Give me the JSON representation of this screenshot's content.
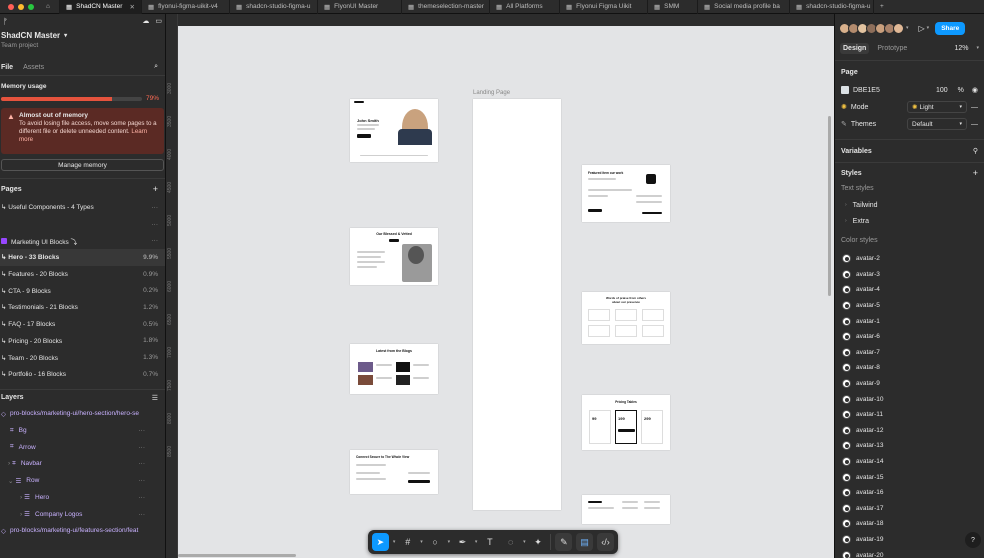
{
  "tabs": [
    {
      "label": "ShadCN Master",
      "active": true
    },
    {
      "label": "flyonui-figma-uikit-v4"
    },
    {
      "label": "shadcn-studio-figma-u"
    },
    {
      "label": "FlyonUI Master"
    },
    {
      "label": "themeselection-master"
    },
    {
      "label": "All Platforms"
    },
    {
      "label": "Flyonui Figma Uikit"
    },
    {
      "label": "SMM"
    },
    {
      "label": "Social media profile ba"
    },
    {
      "label": "shadcn-studio-figma-u"
    }
  ],
  "tabbar": {
    "add": "+"
  },
  "file": {
    "name": "ShadCN Master",
    "team": "Team project"
  },
  "left_tabs": {
    "file": "File",
    "assets": "Assets"
  },
  "memory": {
    "title": "Memory usage",
    "percent": "79%",
    "level": 0.79,
    "warning_title": "Almost out of memory",
    "warning_body": "To avoid losing file access, move some pages to a different file or delete unneeded content.",
    "learn_more": "Learn more",
    "manage": "Manage memory"
  },
  "pages": {
    "title": "Pages",
    "items": [
      {
        "label": "↳ Useful Components - 4 Types",
        "pct": ""
      },
      {
        "label": "",
        "pct": ""
      },
      {
        "label": "Marketing UI Blocks ⤵︎",
        "pct": "",
        "highlight": true
      },
      {
        "label": "↳ Hero - 33 Blocks",
        "pct": "9.9%",
        "selected": true
      },
      {
        "label": "↳ Features - 20 Blocks",
        "pct": "0.9%"
      },
      {
        "label": "↳ CTA - 9 Blocks",
        "pct": "0.2%"
      },
      {
        "label": "↳ Testimonials - 21 Blocks",
        "pct": "1.2%"
      },
      {
        "label": "↳ FAQ - 17 Blocks",
        "pct": "0.5%"
      },
      {
        "label": "↳ Pricing - 20 Blocks",
        "pct": "1.8%"
      },
      {
        "label": "↳ Team - 20 Blocks",
        "pct": "1.3%"
      },
      {
        "label": "↳ Portfolio - 16 Blocks",
        "pct": "0.7%"
      }
    ]
  },
  "layers": {
    "title": "Layers",
    "items": [
      {
        "label": "pro-blocks/marketing-ui/hero-section/hero-se",
        "indent": 0
      },
      {
        "label": "Bg",
        "indent": 1
      },
      {
        "label": "Arrow",
        "indent": 1
      },
      {
        "label": "Navbar",
        "indent": 1
      },
      {
        "label": "Row",
        "indent": 1
      },
      {
        "label": "Hero",
        "indent": 2
      },
      {
        "label": "Company Logos",
        "indent": 2
      },
      {
        "label": "pro-blocks/marketing-ui/features-section/feat",
        "indent": 0
      }
    ]
  },
  "ruler_marks": [
    "3000",
    "3500",
    "4000",
    "4500",
    "5000",
    "5500",
    "6000",
    "6500",
    "7000",
    "7500",
    "8000",
    "8500"
  ],
  "canvas": {
    "landing_label": "Landing Page",
    "thumb1_title": "John Smith",
    "thumb2_title": "Our Blessed & Vetted",
    "thumb3_title": "Latest from the Blogs",
    "thumb4_title": "Connect Secure to The Whole View",
    "thumb5_title": "Featured item our work",
    "thumb6_title": "Words of praise from others about our presence",
    "thumb7_title": "Pricing Tables",
    "prices": [
      "99",
      "199",
      "299"
    ]
  },
  "right": {
    "share": "Share",
    "tab_design": "Design",
    "tab_prototype": "Prototype",
    "zoom": "12%",
    "page_title": "Page",
    "bg_hex": "DBE1E5",
    "bg_opacity": "100",
    "bg_unit": "%",
    "mode_label": "Mode",
    "mode_value": "Light",
    "themes_label": "Themes",
    "themes_value": "Default",
    "variables": "Variables",
    "styles": "Styles",
    "text_styles": "Text styles",
    "text_items": [
      "Tailwind",
      "Extra"
    ],
    "color_styles": "Color styles",
    "colors": [
      "avatar-2",
      "avatar-3",
      "avatar-4",
      "avatar-5",
      "avatar-1",
      "avatar-6",
      "avatar-7",
      "avatar-8",
      "avatar-9",
      "avatar-10",
      "avatar-11",
      "avatar-12",
      "avatar-13",
      "avatar-14",
      "avatar-15",
      "avatar-16",
      "avatar-17",
      "avatar-18",
      "avatar-19",
      "avatar-20"
    ]
  },
  "help": "?",
  "colors_theme": {
    "accent": "#0d99ff",
    "warning_bg": "#5b2a24",
    "memory_bar": "#e5533d",
    "purple": "#9747ff"
  }
}
